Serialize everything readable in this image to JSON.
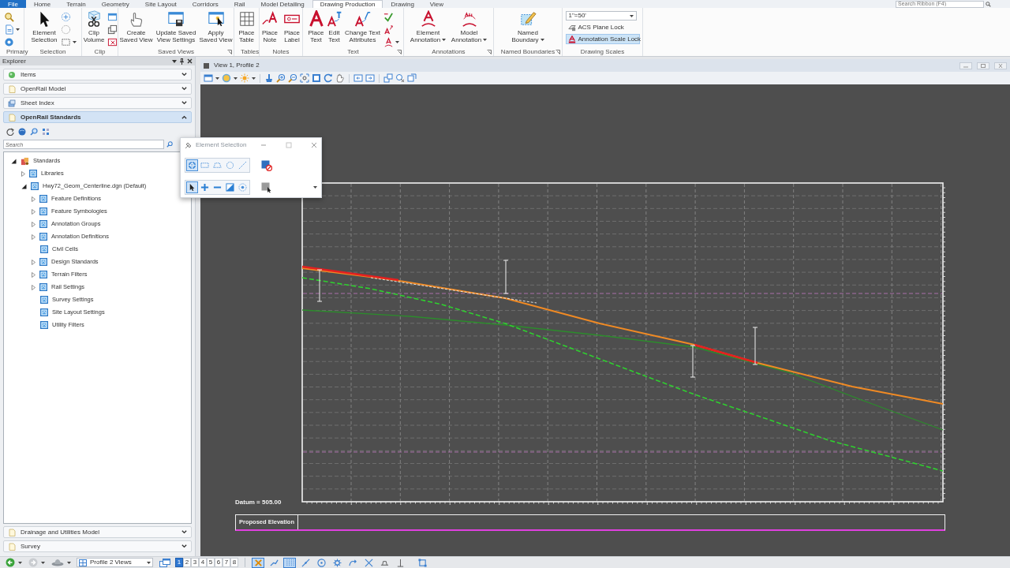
{
  "ribbon": {
    "tabs": [
      {
        "label": "File",
        "kind": "file",
        "selected": false
      },
      {
        "label": "Home",
        "kind": "tab",
        "selected": false
      },
      {
        "label": "Terrain",
        "kind": "tab",
        "selected": false
      },
      {
        "label": "Geometry",
        "kind": "tab",
        "selected": false
      },
      {
        "label": "Site Layout",
        "kind": "tab",
        "selected": false
      },
      {
        "label": "Corridors",
        "kind": "tab",
        "selected": false
      },
      {
        "label": "Rail",
        "kind": "tab",
        "selected": false
      },
      {
        "label": "Model Detailing",
        "kind": "tab",
        "selected": false
      },
      {
        "label": "Drawing Production",
        "kind": "tab",
        "selected": true
      },
      {
        "label": "Drawing",
        "kind": "tab",
        "selected": false
      },
      {
        "label": "View",
        "kind": "tab",
        "selected": false
      }
    ],
    "search": {
      "placeholder": "Search Ribbon (F4)"
    },
    "groups": [
      {
        "label": "Primary",
        "launcher": false,
        "items": [
          {
            "kind": "column",
            "tools": [
              {
                "dropdown": false
              },
              {
                "dropdown": true
              },
              {
                "dropdown": false
              }
            ]
          }
        ]
      },
      {
        "label": "Selection",
        "launcher": false,
        "items": [
          {
            "kind": "large",
            "label": "Element Selection",
            "dropdown": false
          },
          {
            "kind": "column",
            "tools": [
              {
                "dropdown": false
              },
              {
                "dropdown": false
              },
              {
                "dropdown": true
              }
            ]
          }
        ]
      },
      {
        "label": "Clip",
        "launcher": false,
        "items": [
          {
            "kind": "large",
            "label": "Clip Volume",
            "dropdown": false
          },
          {
            "kind": "column",
            "tools": [
              {
                "dropdown": false
              },
              {
                "dropdown": false
              },
              {
                "dropdown": false
              }
            ]
          }
        ]
      },
      {
        "label": "Saved Views",
        "launcher": true,
        "items": [
          {
            "kind": "large",
            "label": "Create Saved View",
            "dropdown": false
          },
          {
            "kind": "large",
            "label": "Update Saved View Settings",
            "dropdown": false
          },
          {
            "kind": "large",
            "label": "Apply Saved View",
            "dropdown": false
          }
        ]
      },
      {
        "label": "Tables",
        "launcher": false,
        "items": [
          {
            "kind": "large",
            "label": "Place Table",
            "dropdown": false
          }
        ]
      },
      {
        "label": "Notes",
        "launcher": false,
        "items": [
          {
            "kind": "large",
            "label": "Place Note",
            "dropdown": false
          },
          {
            "kind": "large",
            "label": "Place Label",
            "dropdown": false
          }
        ]
      },
      {
        "label": "Text",
        "launcher": true,
        "items": [
          {
            "kind": "large",
            "label": "Place Text",
            "dropdown": false
          },
          {
            "kind": "large",
            "label": "Edit Text",
            "dropdown": false
          },
          {
            "kind": "large",
            "label": "Change Text Attributes",
            "dropdown": false
          },
          {
            "kind": "column",
            "tools": [
              {
                "dropdown": false
              },
              {
                "dropdown": false
              },
              {
                "dropdown": true
              }
            ]
          }
        ]
      },
      {
        "label": "Annotations",
        "launcher": true,
        "items": [
          {
            "kind": "large",
            "label": "Element Annotation",
            "dropdown": true
          },
          {
            "kind": "large",
            "label": "Model Annotation",
            "dropdown": true
          }
        ]
      },
      {
        "label": "Named Boundaries",
        "launcher": true,
        "items": [
          {
            "kind": "large",
            "label": "Named Boundary",
            "dropdown": true
          }
        ]
      },
      {
        "label": "Drawing Scales",
        "launcher": false,
        "items": [
          {
            "kind": "select",
            "value": "1\"=50'"
          },
          {
            "kind": "toggle",
            "label": "ACS Plane Lock",
            "on": false
          },
          {
            "kind": "toggle",
            "label": "Annotation Scale Lock",
            "on": true
          }
        ]
      }
    ]
  },
  "explorer": {
    "title": "Explorer",
    "sections": [
      {
        "label": "Items",
        "expanded": false
      },
      {
        "label": "OpenRail Model",
        "expanded": false
      },
      {
        "label": "Sheet Index",
        "expanded": false
      },
      {
        "label": "OpenRail Standards",
        "expanded": true,
        "search": {
          "placeholder": "Search"
        },
        "tree": [
          {
            "label": "Standards",
            "expander": true,
            "expanded": true,
            "children": [
              {
                "label": "Libraries",
                "expander": true,
                "expanded": false
              },
              {
                "label": "Hwy72_Geom_Centerline.dgn (Default)",
                "expander": true,
                "expanded": true,
                "children": [
                  {
                    "label": "Feature Definitions",
                    "expander": true,
                    "expanded": false
                  },
                  {
                    "label": "Feature Symbologies",
                    "expander": true,
                    "expanded": false
                  },
                  {
                    "label": "Annotation Groups",
                    "expander": true,
                    "expanded": false
                  },
                  {
                    "label": "Annotation Definitions",
                    "expander": true,
                    "expanded": false
                  },
                  {
                    "label": "Civil Cells",
                    "expander": false,
                    "expanded": false
                  },
                  {
                    "label": "Design Standards",
                    "expander": true,
                    "expanded": false
                  },
                  {
                    "label": "Terrain Filters",
                    "expander": true,
                    "expanded": false
                  },
                  {
                    "label": "Rail Settings",
                    "expander": true,
                    "expanded": false
                  },
                  {
                    "label": "Survey Settings",
                    "expander": false,
                    "expanded": false
                  },
                  {
                    "label": "Site Layout Settings",
                    "expander": false,
                    "expanded": false
                  },
                  {
                    "label": "Utility Filters",
                    "expander": false,
                    "expanded": false
                  }
                ]
              }
            ]
          }
        ]
      },
      {
        "label": "Drainage and Utilities Model",
        "expanded": false
      },
      {
        "label": "Survey",
        "expanded": false
      }
    ]
  },
  "view": {
    "title": "View 1, Profile 2",
    "profile": {
      "datum": "Datum = 505.00",
      "band": {
        "label": "Proposed Elevation"
      }
    }
  },
  "element_selection": {
    "title": "Element Selection",
    "methods": [
      {
        "selected": true
      },
      {
        "selected": false
      },
      {
        "selected": false
      },
      {
        "selected": false
      },
      {
        "selected": false
      }
    ],
    "modes": [
      {
        "selected": true
      },
      {
        "selected": false
      },
      {
        "selected": false
      },
      {
        "selected": false
      },
      {
        "selected": false
      }
    ]
  },
  "status_bar": {
    "view_group": "Profile 2 Views",
    "views": [
      {
        "label": "1",
        "selected": true
      },
      {
        "label": "2",
        "selected": false
      },
      {
        "label": "3",
        "selected": false
      },
      {
        "label": "4",
        "selected": false
      },
      {
        "label": "5",
        "selected": false
      },
      {
        "label": "6",
        "selected": false
      },
      {
        "label": "7",
        "selected": false
      },
      {
        "label": "8",
        "selected": false
      }
    ],
    "snaps": [
      {
        "selected": true
      },
      {
        "selected": false
      },
      {
        "selected": true
      },
      {
        "selected": false
      },
      {
        "selected": false
      },
      {
        "selected": false
      },
      {
        "selected": false
      },
      {
        "selected": false
      },
      {
        "selected": false
      },
      {
        "selected": false
      },
      {
        "selected": false
      }
    ]
  }
}
